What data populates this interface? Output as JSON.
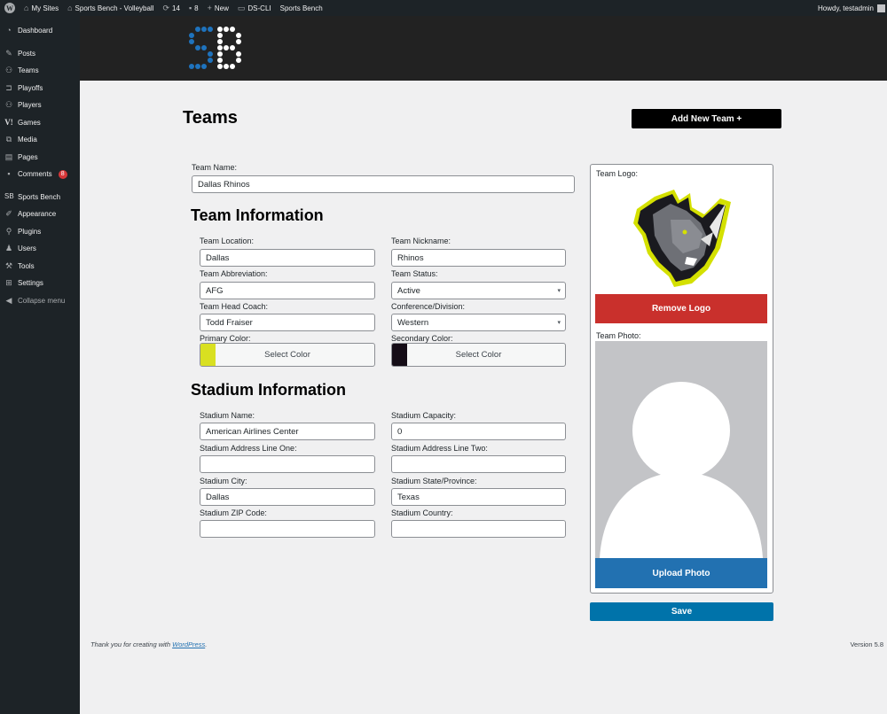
{
  "adminbar": {
    "my_sites": "My Sites",
    "site_name": "Sports Bench - Volleyball",
    "updates_count": "14",
    "comments_count": "8",
    "new_label": "New",
    "ds_cli": "DS-CLI",
    "sports_bench": "Sports Bench",
    "howdy": "Howdy, testadmin"
  },
  "sidebar": {
    "items": [
      {
        "label": "Dashboard",
        "icon": "dashboard-icon"
      },
      {
        "label": "Posts",
        "icon": "pin-icon"
      },
      {
        "label": "Teams",
        "icon": "groups-icon"
      },
      {
        "label": "Playoffs",
        "icon": "bracket-icon"
      },
      {
        "label": "Players",
        "icon": "groups-icon"
      },
      {
        "label": "Games",
        "icon": "versus-icon"
      },
      {
        "label": "Media",
        "icon": "media-icon"
      },
      {
        "label": "Pages",
        "icon": "pages-icon"
      },
      {
        "label": "Comments",
        "icon": "comment-icon",
        "badge": "8"
      },
      {
        "label": "Sports Bench",
        "icon": "sb-icon"
      },
      {
        "label": "Appearance",
        "icon": "brush-icon"
      },
      {
        "label": "Plugins",
        "icon": "plugin-icon"
      },
      {
        "label": "Users",
        "icon": "user-icon"
      },
      {
        "label": "Tools",
        "icon": "wrench-icon"
      },
      {
        "label": "Settings",
        "icon": "settings-icon"
      },
      {
        "label": "Collapse menu",
        "icon": "collapse-icon"
      }
    ]
  },
  "header": {
    "logo_text": "SB",
    "page_title": "Teams",
    "add_new_label": "Add New Team +"
  },
  "form": {
    "team_name": {
      "label": "Team Name:",
      "value": "Dallas Rhinos"
    },
    "team_info_title": "Team Information",
    "team_location": {
      "label": "Team Location:",
      "value": "Dallas"
    },
    "team_nickname": {
      "label": "Team Nickname:",
      "value": "Rhinos"
    },
    "team_abbreviation": {
      "label": "Team Abbreviation:",
      "value": "AFG"
    },
    "team_status": {
      "label": "Team Status:",
      "value": "Active"
    },
    "team_head_coach": {
      "label": "Team Head Coach:",
      "value": "Todd Fraiser"
    },
    "conference_division": {
      "label": "Conference/Division:",
      "value": "Western"
    },
    "primary_color": {
      "label": "Primary Color:",
      "button": "Select Color",
      "color": "#d9e021"
    },
    "secondary_color": {
      "label": "Secondary Color:",
      "button": "Select Color",
      "color": "#150d17"
    },
    "stadium_info_title": "Stadium Information",
    "stadium_name": {
      "label": "Stadium Name:",
      "value": "American Airlines Center"
    },
    "stadium_capacity": {
      "label": "Stadium Capacity:",
      "value": "0"
    },
    "stadium_address_one": {
      "label": "Stadium Address Line One:",
      "value": ""
    },
    "stadium_address_two": {
      "label": "Stadium Address Line Two:",
      "value": ""
    },
    "stadium_city": {
      "label": "Stadium City:",
      "value": "Dallas"
    },
    "stadium_state": {
      "label": "Stadium State/Province:",
      "value": "Texas"
    },
    "stadium_zip": {
      "label": "Stadium ZIP Code:",
      "value": ""
    },
    "stadium_country": {
      "label": "Stadium Country:",
      "value": ""
    }
  },
  "media": {
    "logo_label": "Team Logo:",
    "remove_logo": "Remove Logo",
    "photo_label": "Team Photo:",
    "upload_photo": "Upload Photo",
    "save": "Save"
  },
  "footer": {
    "thanks_prefix": "Thank you for creating with ",
    "wordpress_link": "WordPress",
    "thanks_suffix": ".",
    "version": "Version 5.8"
  },
  "colors": {
    "remove_logo": "#c9302c",
    "upload_photo": "#2271b1",
    "save": "#0073aa",
    "logo_blue": "#1e73be"
  }
}
